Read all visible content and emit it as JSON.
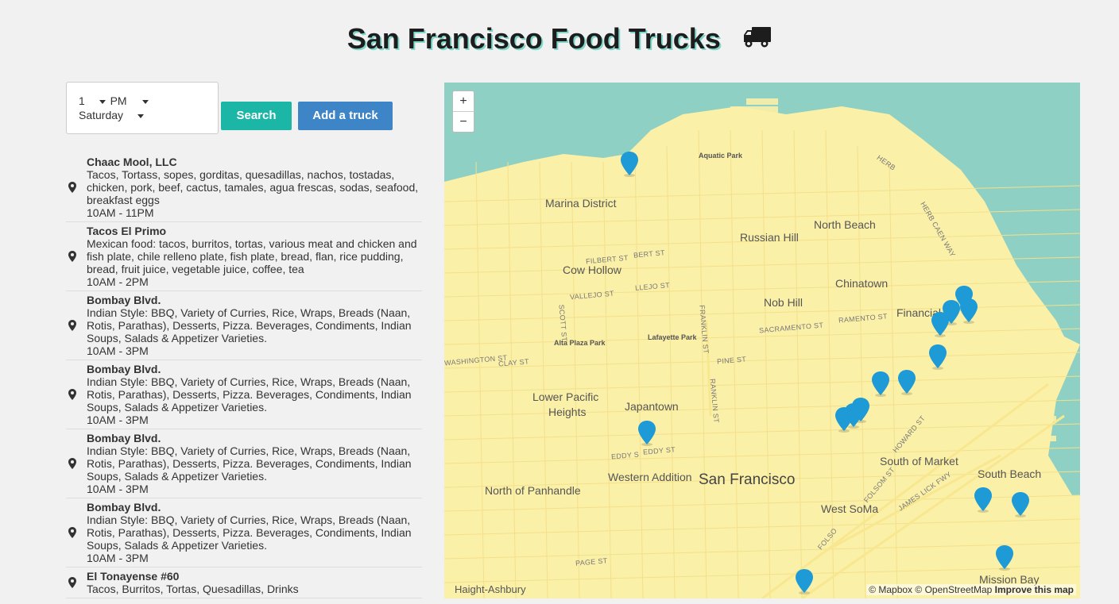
{
  "header": {
    "title": "San Francisco Food Trucks",
    "icon": "truck-icon"
  },
  "controls": {
    "hour": "1",
    "ampm": "PM",
    "day": "Saturday",
    "search_label": "Search",
    "add_label": "Add a truck",
    "colors": {
      "search": "#1bb6a6",
      "add": "#3d85c6"
    }
  },
  "trucks": [
    {
      "name": "Chaac Mool, LLC",
      "food": "Tacos, Tortass, sopes, gorditas, quesadillas, nachos, tostadas, chicken, pork, beef, cactus, tamales, agua frescas, sodas, seafood, breakfast eggs",
      "hours": "10AM - 11PM"
    },
    {
      "name": "Tacos El Primo",
      "food": "Mexican food: tacos, burritos, tortas, various meat and chicken and fish plate, chile relleno plate, fish plate, bread, flan, rice pudding, bread, fruit juice, vegetable juice, coffee, tea",
      "hours": "10AM - 2PM"
    },
    {
      "name": "Bombay Blvd.",
      "food": "Indian Style: BBQ, Variety of Curries, Rice, Wraps, Breads (Naan, Rotis, Parathas), Desserts, Pizza. Beverages, Condiments, Indian Soups, Salads & Appetizer Varieties.",
      "hours": "10AM - 3PM"
    },
    {
      "name": "Bombay Blvd.",
      "food": "Indian Style: BBQ, Variety of Curries, Rice, Wraps, Breads (Naan, Rotis, Parathas), Desserts, Pizza. Beverages, Condiments, Indian Soups, Salads & Appetizer Varieties.",
      "hours": "10AM - 3PM"
    },
    {
      "name": "Bombay Blvd.",
      "food": "Indian Style: BBQ, Variety of Curries, Rice, Wraps, Breads (Naan, Rotis, Parathas), Desserts, Pizza. Beverages, Condiments, Indian Soups, Salads & Appetizer Varieties.",
      "hours": "10AM - 3PM"
    },
    {
      "name": "Bombay Blvd.",
      "food": "Indian Style: BBQ, Variety of Curries, Rice, Wraps, Breads (Naan, Rotis, Parathas), Desserts, Pizza. Beverages, Condiments, Indian Soups, Salads & Appetizer Varieties.",
      "hours": "10AM - 3PM"
    },
    {
      "name": "El Tonayense #60",
      "food": "Tacos, Burritos, Tortas, Quesadillas, Drinks",
      "hours": ""
    }
  ],
  "map": {
    "zoom_in": "+",
    "zoom_out": "−",
    "colors": {
      "land": "#fbf0a8",
      "water": "#8fd0c5",
      "marker": "#1e9ad6"
    },
    "labels": {
      "city": "San Francisco",
      "marina": "Marina District",
      "north_beach": "North Beach",
      "russian_hill": "Russian Hill",
      "cow_hollow": "Cow Hollow",
      "chinatown": "Chinatown",
      "nob_hill": "Nob Hill",
      "financial": "Financial",
      "lower_pacific": "Lower Pacific",
      "heights": "Heights",
      "japantown": "Japantown",
      "south_of_market": "South of Market",
      "south_beach": "South Beach",
      "western_addition": "Western Addition",
      "north_panhandle": "North of Panhandle",
      "west_soma": "West SoMa",
      "mission_bay": "Mission Bay",
      "haight": "Haight-Ashbury",
      "aquatic_park": "Aquatic Park",
      "alta_plaza": "Alta Plaza Park",
      "lafayette": "Lafayette Park",
      "filbert": "FILBERT ST",
      "bert": "BERT ST",
      "vallejo": "VALLEJO ST",
      "llejo": "LLEJO ST",
      "sacramento": "SACRAMENTO ST",
      "ramento": "RAMENTO ST",
      "washington": "WASHINGTON ST",
      "clay": "CLAY ST",
      "pine": "PINE ST",
      "eddy1": "EDDY S",
      "eddy2": "EDDY ST",
      "howard": "HOWARD ST",
      "folsom": "FOLSOM ST",
      "folso": "FOLSO",
      "james": "JAMES LICK FWY",
      "page": "PAGE ST",
      "scott": "SCOTT ST",
      "franklin": "FRANKLIN ST",
      "franklin2": "RANKLIN ST",
      "herb": "HERB",
      "herb_caen": "HERB CAEN WAY"
    },
    "attribution": {
      "mapbox": "© Mapbox",
      "osm": "© OpenStreetMap",
      "improve": "Improve this map"
    }
  }
}
